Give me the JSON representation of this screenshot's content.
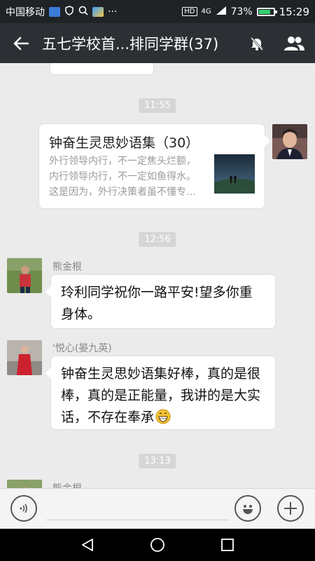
{
  "status_bar": {
    "carrier": "中国移动",
    "more": "···",
    "network": "4G",
    "battery_percent": "73%",
    "battery_level": 0.73,
    "time": "15:29"
  },
  "header": {
    "title": "五七学校首...排同学群(37)",
    "icons": [
      "back-arrow-icon",
      "mute-bell-icon",
      "group-members-icon"
    ]
  },
  "chat": {
    "timestamps": [
      "11:55",
      "12:56",
      "13:13"
    ],
    "shared_card": {
      "title": "钟奋生灵思妙语集（30）",
      "desc_lines": [
        "外行领导内行，不一定焦头烂额，",
        "内行领导内行，不一定如鱼得水。",
        "这是因为，外行决策者虽不懂专…"
      ]
    },
    "messages": [
      {
        "name": "熊金根",
        "text": "玲利同学祝你一路平安!望多你重身体。"
      },
      {
        "name": "'悦心(晏九英)",
        "text": "钟奋生灵思妙语集好棒，真的是很棒，真的是正能量，我讲的是大实话，不存在奉承"
      }
    ],
    "partial_name": "熊金根"
  },
  "input_bar": {
    "icons": [
      "voice-icon",
      "emoji-icon",
      "add-icon"
    ]
  },
  "colors": {
    "header_bg": "#2c3034",
    "chat_bg": "#ebebeb",
    "bubble_bg": "#ffffff",
    "timestamp_bg": "#d6d6d6"
  }
}
